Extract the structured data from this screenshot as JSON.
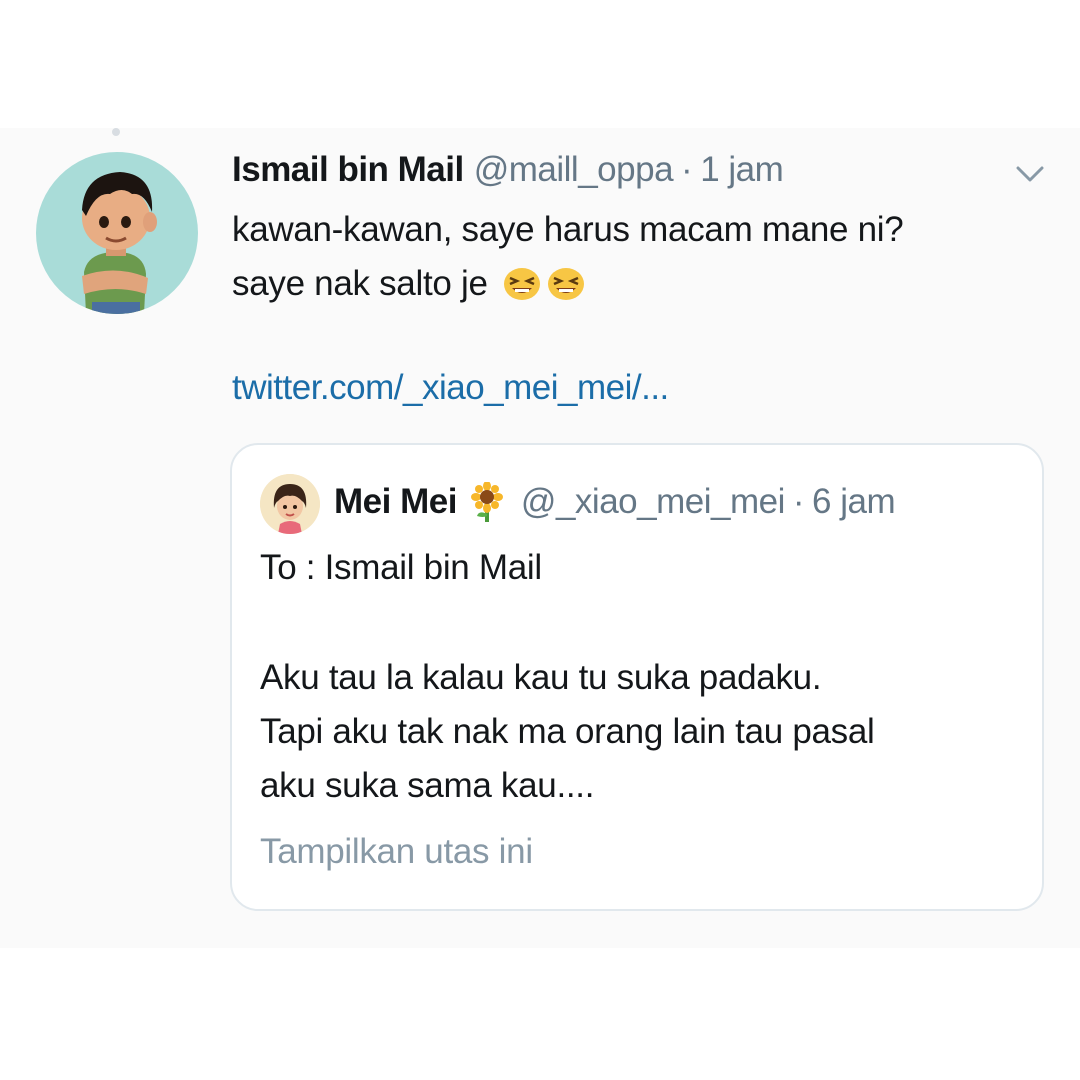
{
  "tweet": {
    "author_name": "Ismail bin Mail",
    "handle": "@maill_oppa",
    "separator": "·",
    "time": "1 jam",
    "text_line1": "kawan-kawan, saye harus macam mane ni?",
    "text_line2": "saye nak salto je",
    "emojis": [
      "tired-face-emoji",
      "tired-face-emoji"
    ],
    "link": "twitter.com/_xiao_mei_mei/...",
    "menu_icon": "chevron-down-icon"
  },
  "quoted_tweet": {
    "author_name": "Mei Mei",
    "name_emoji": "sunflower-icon",
    "handle": "@_xiao_mei_mei",
    "separator": "·",
    "time": "6 jam",
    "line1": "To : Ismail bin Mail",
    "line2": "Aku tau la kalau kau tu suka padaku.",
    "line3": "Tapi aku tak nak ma orang lain tau pasal",
    "line4": "aku suka sama kau....",
    "show_thread": "Tampilkan utas ini"
  },
  "colors": {
    "background": "#ffffff",
    "tweet_background": "#fafafa",
    "text": "#14171a",
    "muted": "#657786",
    "link": "#1b6da8",
    "border": "#e1e8ed",
    "avatar_bg": "#a9dcd8"
  }
}
